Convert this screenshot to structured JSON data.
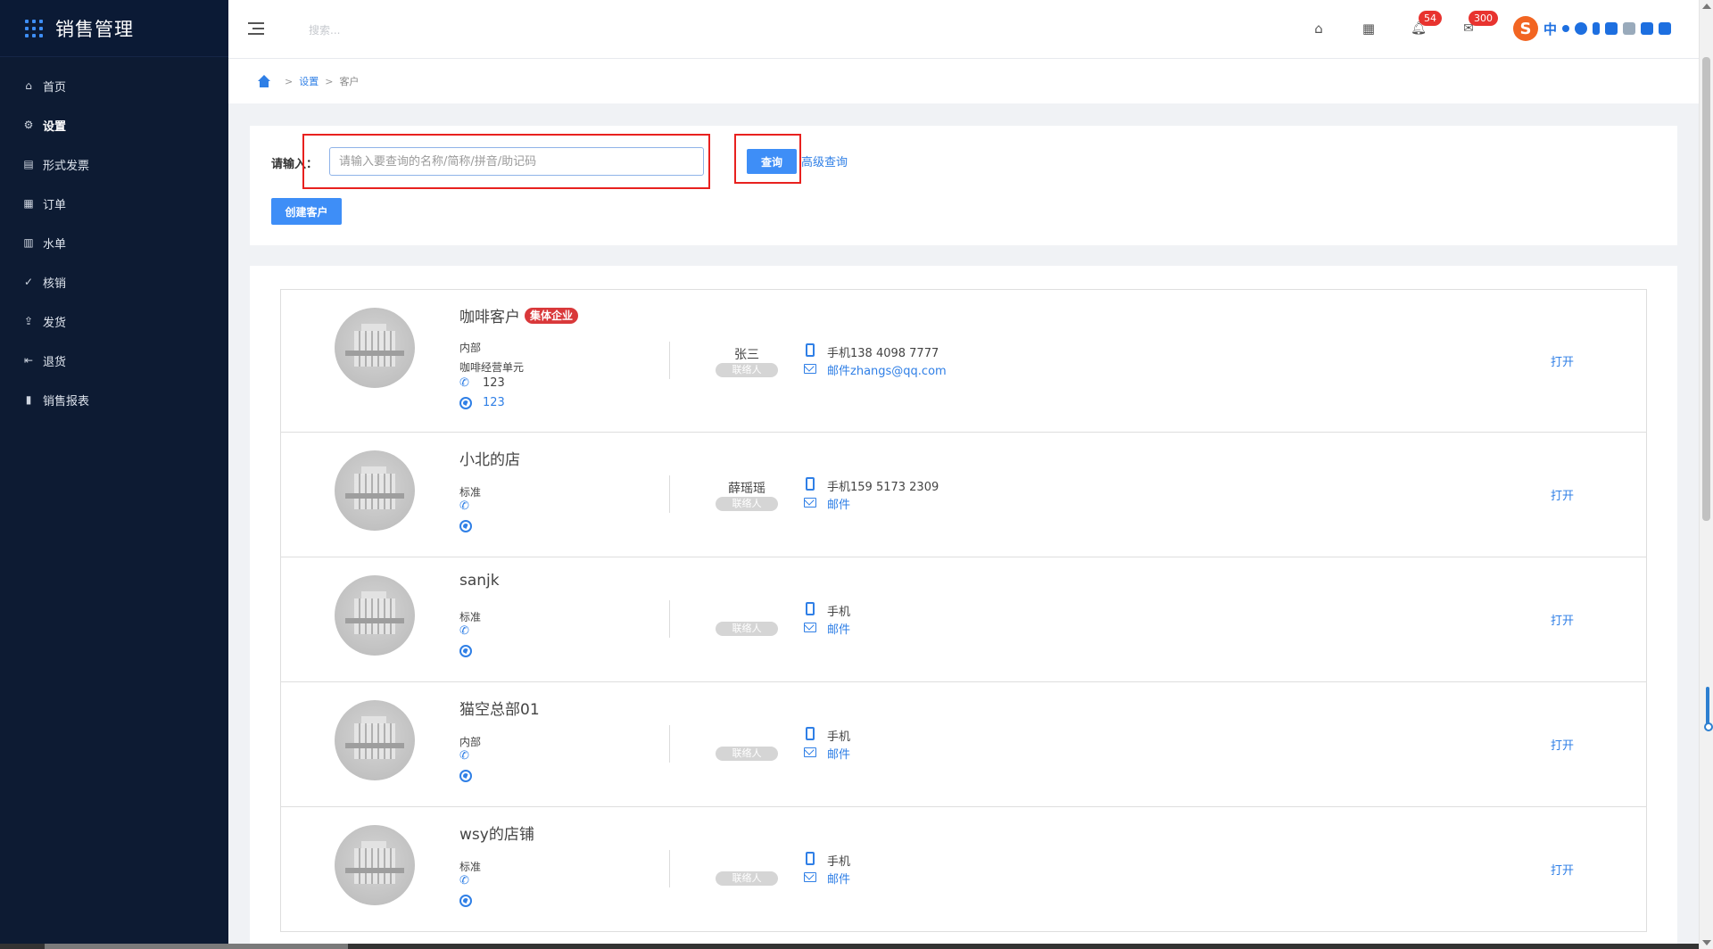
{
  "app": {
    "title": "销售管理"
  },
  "sidebar": {
    "items": [
      {
        "label": "首页",
        "icon": "home-icon",
        "glyph": "⌂",
        "active": false
      },
      {
        "label": "设置",
        "icon": "gear-icon",
        "glyph": "⚙",
        "active": true
      },
      {
        "label": "形式发票",
        "icon": "invoice-icon",
        "glyph": "▤",
        "active": false
      },
      {
        "label": "订单",
        "icon": "order-icon",
        "glyph": "▦",
        "active": false
      },
      {
        "label": "水单",
        "icon": "receipt-icon",
        "glyph": "▥",
        "active": false
      },
      {
        "label": "核销",
        "icon": "check-circle-icon",
        "glyph": "✓",
        "active": false
      },
      {
        "label": "发货",
        "icon": "upload-icon",
        "glyph": "⇪",
        "active": false
      },
      {
        "label": "退货",
        "icon": "return-icon",
        "glyph": "⇤",
        "active": false
      },
      {
        "label": "销售报表",
        "icon": "bar-chart-icon",
        "glyph": "▮",
        "active": false
      }
    ]
  },
  "header": {
    "search_placeholder": "搜索...",
    "notifications_count": "54",
    "messages_count": "300",
    "ime": {
      "logo": "S",
      "lang": "中"
    }
  },
  "breadcrumb": {
    "items": [
      "设置",
      "客户"
    ]
  },
  "search": {
    "label": "请输入：",
    "placeholder": "请输入要查询的名称/简称/拼音/助记码",
    "value": "",
    "query_label": "查询",
    "advanced_label": "高级查询",
    "create_label": "创建客户"
  },
  "customers": [
    {
      "name": "咖啡客户",
      "tag": "集体企业",
      "type": "内部",
      "unit": "咖啡经营单元",
      "phone": "123",
      "website": "123",
      "contact": "张三",
      "contact_tag": "联络人",
      "mobile": "手机138 4098 7777",
      "email": "邮件zhangs@qq.com",
      "action": "打开"
    },
    {
      "name": "小北的店",
      "tag": "",
      "type": "标准",
      "unit": "",
      "phone": "",
      "website": "",
      "contact": "薛瑶瑶",
      "contact_tag": "联络人",
      "mobile": "手机159 5173 2309",
      "email": "邮件",
      "action": "打开"
    },
    {
      "name": "sanjk",
      "tag": "",
      "type": "标准",
      "unit": "",
      "phone": "",
      "website": "",
      "contact": "",
      "contact_tag": "联络人",
      "mobile": "手机",
      "email": "邮件",
      "action": "打开"
    },
    {
      "name": "猫空总部01",
      "tag": "",
      "type": "内部",
      "unit": "",
      "phone": "",
      "website": "",
      "contact": "",
      "contact_tag": "联络人",
      "mobile": "手机",
      "email": "邮件",
      "action": "打开"
    },
    {
      "name": "wsy的店铺",
      "tag": "",
      "type": "标准",
      "unit": "",
      "phone": "",
      "website": "",
      "contact": "",
      "contact_tag": "联络人",
      "mobile": "手机",
      "email": "邮件",
      "action": "打开"
    }
  ],
  "colors": {
    "sidebar_bg": "#0d1b33",
    "accent": "#3e8ef7",
    "highlight": "#e8211f",
    "tag_red": "#d9383a"
  }
}
